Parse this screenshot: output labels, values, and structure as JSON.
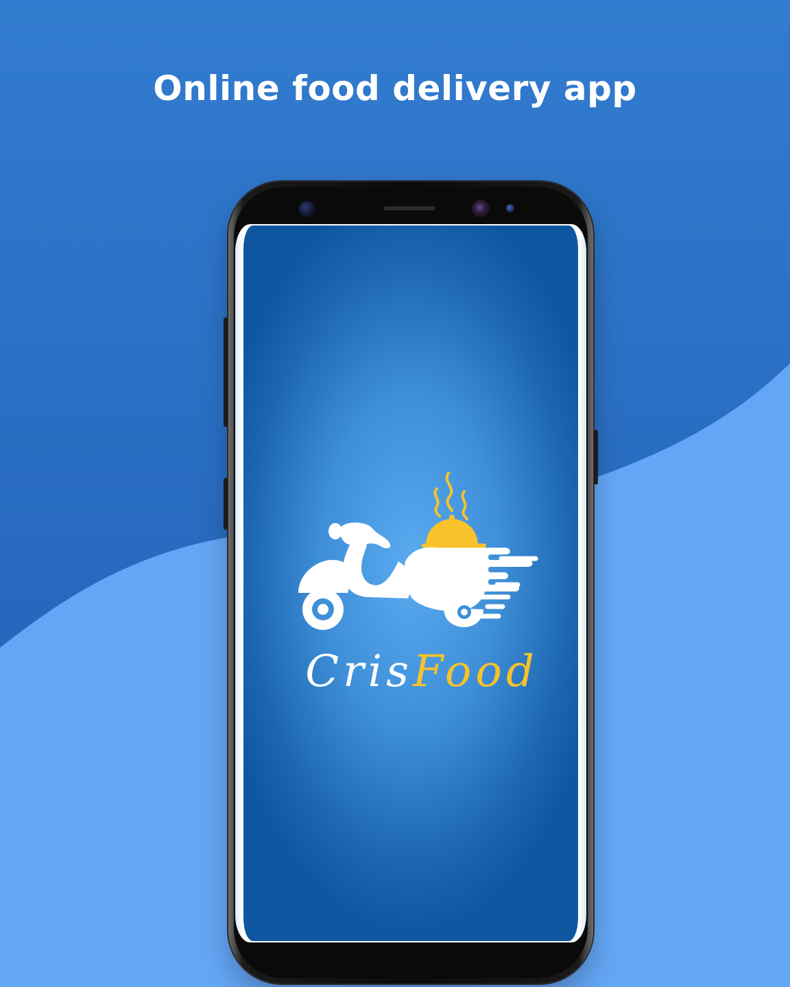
{
  "headline": "Online food delivery app",
  "brand": {
    "part1": "Cris",
    "part2": "Food"
  },
  "colors": {
    "background_dark": "#2a6bc2",
    "background_light": "#64a6f5",
    "brand_yellow": "#f8c22a",
    "white": "#ffffff"
  },
  "icons": [
    "scooter-icon",
    "food-cloche-icon",
    "steam-icon",
    "speed-lines-icon"
  ]
}
